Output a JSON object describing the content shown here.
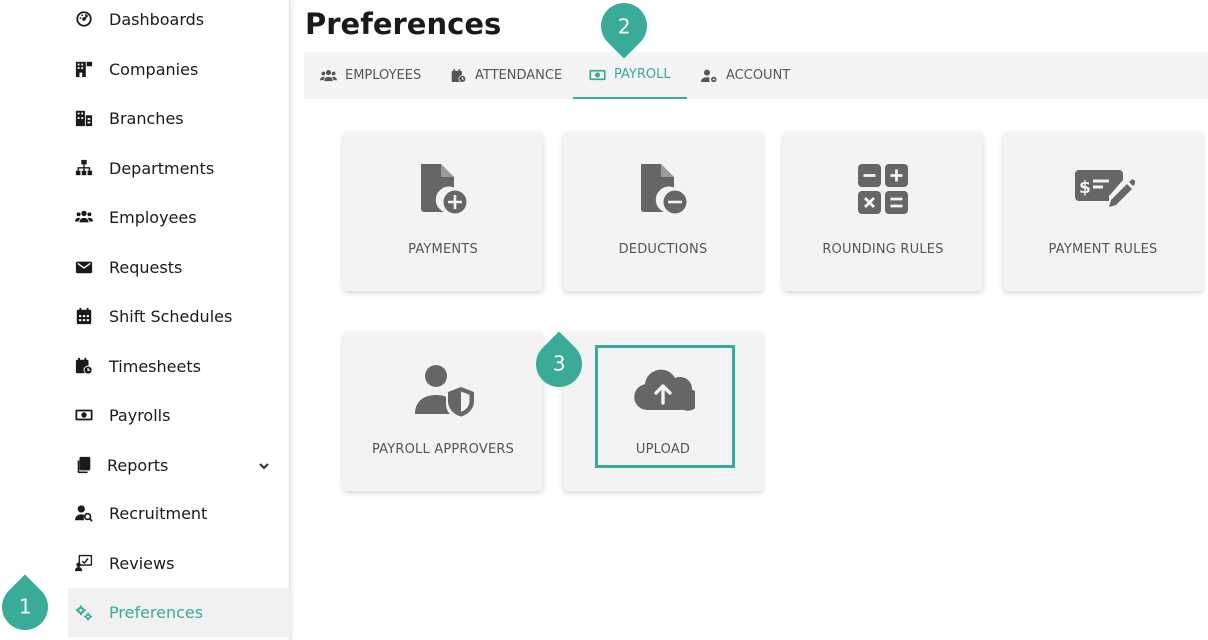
{
  "sidebar": {
    "items": [
      {
        "label": "Dashboards",
        "icon": "dashboard-icon"
      },
      {
        "label": "Companies",
        "icon": "companies-icon"
      },
      {
        "label": "Branches",
        "icon": "branches-icon"
      },
      {
        "label": "Departments",
        "icon": "sitemap-icon"
      },
      {
        "label": "Employees",
        "icon": "users-icon"
      },
      {
        "label": "Requests",
        "icon": "envelope-icon"
      },
      {
        "label": "Shift Schedules",
        "icon": "calendar-icon"
      },
      {
        "label": "Timesheets",
        "icon": "calendar-clock-icon"
      },
      {
        "label": "Payrolls",
        "icon": "money-bill-icon"
      },
      {
        "label": "Reports",
        "icon": "copy-icon"
      },
      {
        "label": "Recruitment",
        "icon": "user-search-icon"
      },
      {
        "label": "Reviews",
        "icon": "review-board-icon"
      },
      {
        "label": "Preferences",
        "icon": "gears-icon"
      }
    ],
    "active": "Preferences"
  },
  "page": {
    "title": "Preferences"
  },
  "tabs": [
    {
      "label": "EMPLOYEES",
      "icon": "users-icon"
    },
    {
      "label": "ATTENDANCE",
      "icon": "calendar-clock-icon"
    },
    {
      "label": "PAYROLL",
      "icon": "money-bill-icon"
    },
    {
      "label": "ACCOUNT",
      "icon": "user-gear-icon"
    }
  ],
  "active_tab": "PAYROLL",
  "cards": [
    {
      "label": "PAYMENTS",
      "icon": "file-plus-icon"
    },
    {
      "label": "DEDUCTIONS",
      "icon": "file-minus-icon"
    },
    {
      "label": "ROUNDING RULES",
      "icon": "calculator-icon"
    },
    {
      "label": "PAYMENT RULES",
      "icon": "money-check-pen-icon"
    },
    {
      "label": "PAYROLL APPROVERS",
      "icon": "user-shield-icon"
    },
    {
      "label": "UPLOAD",
      "icon": "cloud-upload-icon"
    }
  ],
  "callouts": [
    "1",
    "2",
    "3"
  ],
  "colors": {
    "accent": "#3aab98",
    "icon": "#666666",
    "card_bg": "#f3f3f3",
    "tabbar_bg": "#f4f4f4"
  }
}
